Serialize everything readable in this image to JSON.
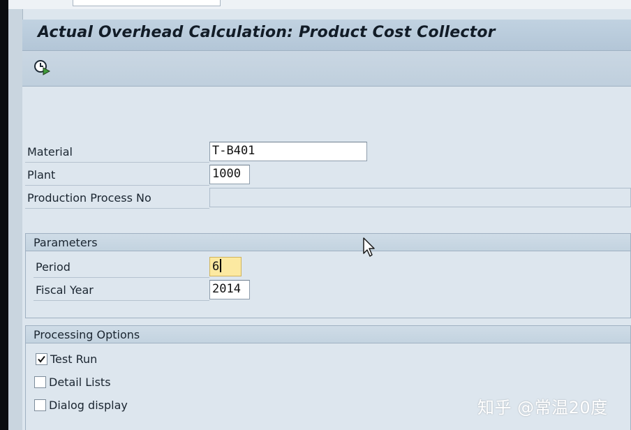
{
  "window": {
    "title": "Actual Overhead Calculation: Product Cost Collector"
  },
  "toolbar": {
    "execute_icon": "execute-clock-icon"
  },
  "selection": {
    "material_label": "Material",
    "material_value": "T-B401",
    "plant_label": "Plant",
    "plant_value": "1000",
    "production_process_label": "Production Process No",
    "production_process_value": ""
  },
  "parameters": {
    "title": "Parameters",
    "period_label": "Period",
    "period_value": "6",
    "fiscal_year_label": "Fiscal Year",
    "fiscal_year_value": "2014"
  },
  "processing_options": {
    "title": "Processing Options",
    "items": [
      {
        "label": "Test Run",
        "checked": true
      },
      {
        "label": "Detail Lists",
        "checked": false
      },
      {
        "label": "Dialog display",
        "checked": false
      }
    ]
  },
  "watermark": "知乎 @常温20度",
  "colors": {
    "title_bar": "#b9cbdb",
    "background": "#dde6ee",
    "focused_field": "#fce9a1"
  }
}
